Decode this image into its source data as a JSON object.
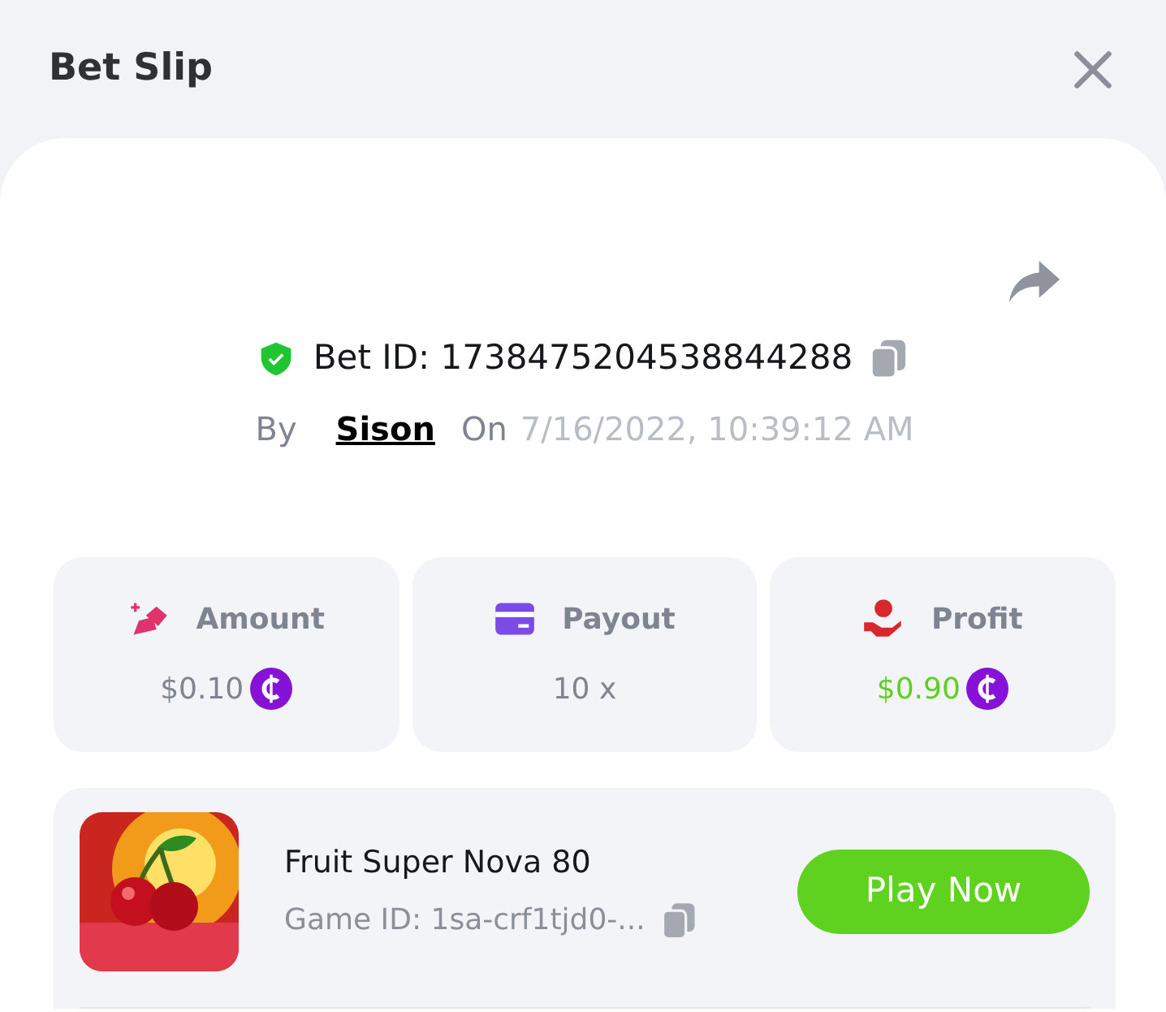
{
  "header": {
    "title": "Bet Slip"
  },
  "bet": {
    "verified": true,
    "id_label": "Bet ID: 1738475204538844288",
    "by_label": "By",
    "user": "Sison",
    "on_label": "On",
    "date": "7/16/2022, 10:39:12 AM"
  },
  "stats": [
    {
      "kind": "amount",
      "label": "Amount",
      "value": "$0.10",
      "coin": true,
      "color": "#7f8590"
    },
    {
      "kind": "payout",
      "label": "Payout",
      "value": "10 x",
      "coin": false,
      "color": "#7f8590"
    },
    {
      "kind": "profit",
      "label": "Profit",
      "value": "$0.90",
      "coin": true,
      "color": "#5fcf22"
    }
  ],
  "game": {
    "title": "Fruit Super Nova 80",
    "id_label": "Game ID: 1sa-crf1tjd0-...",
    "button": "Play Now"
  }
}
